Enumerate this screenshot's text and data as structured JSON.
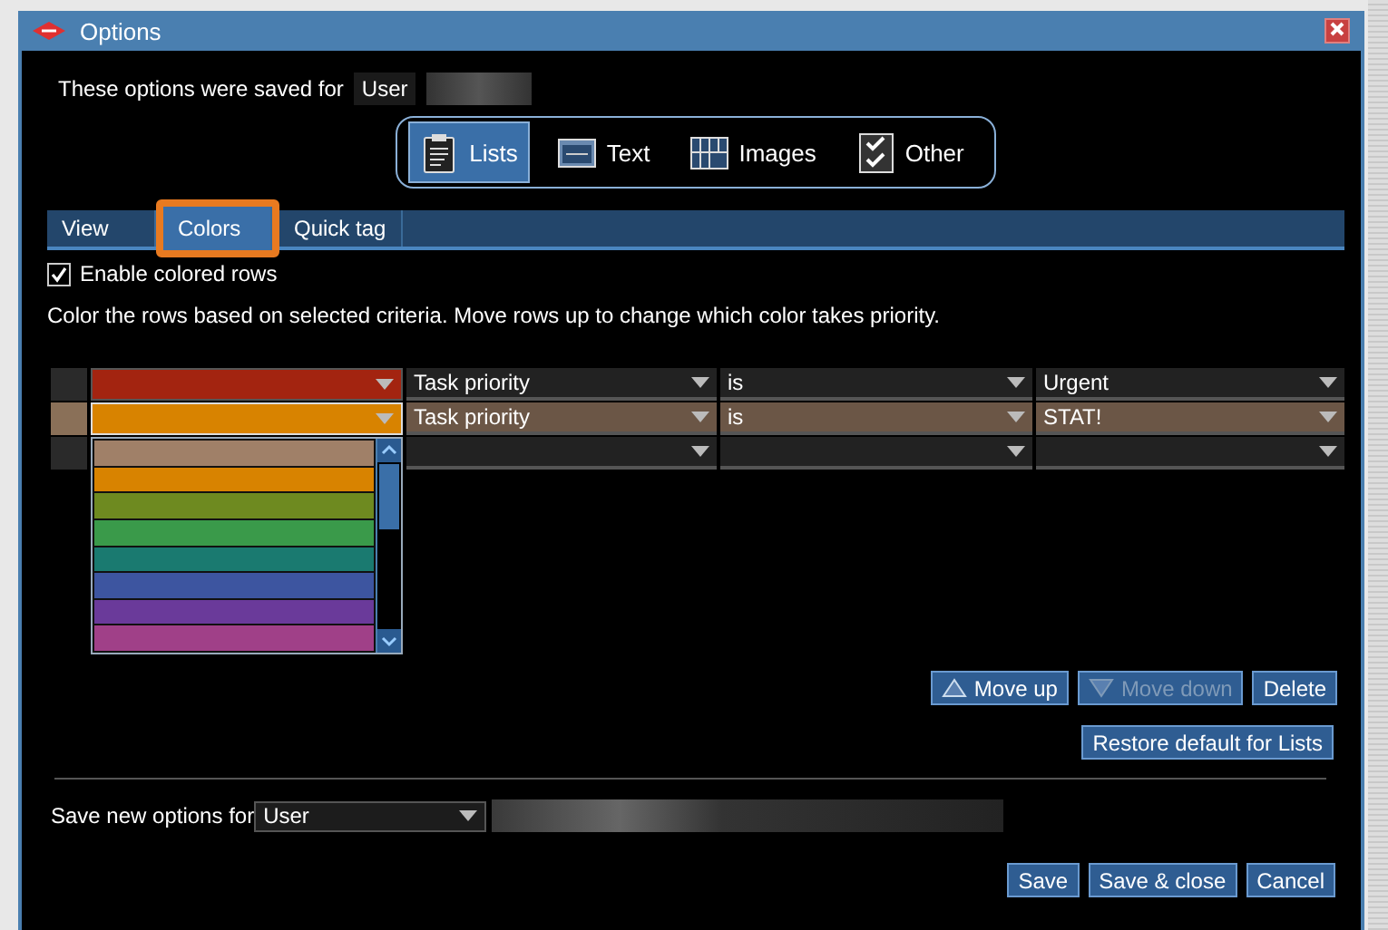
{
  "window": {
    "title": "Options"
  },
  "saved_for": {
    "label": "These options were saved for",
    "user": "User"
  },
  "categories": [
    {
      "label": "Lists",
      "kind": "lists",
      "selected": true
    },
    {
      "label": "Text",
      "kind": "text",
      "selected": false
    },
    {
      "label": "Images",
      "kind": "images",
      "selected": false
    },
    {
      "label": "Other",
      "kind": "other",
      "selected": false
    }
  ],
  "tabs": [
    {
      "label": "View",
      "selected": false,
      "highlighted": false
    },
    {
      "label": "Colors",
      "selected": true,
      "highlighted": true
    },
    {
      "label": "Quick tag",
      "selected": false,
      "highlighted": false
    }
  ],
  "enable_colored_rows": {
    "label": "Enable colored rows",
    "checked": true
  },
  "description": "Color the rows based on selected criteria. Move rows up to change which color takes priority.",
  "rules": [
    {
      "color": "#a32410",
      "field": "Task priority",
      "operator": "is",
      "value": "Urgent",
      "selected": false
    },
    {
      "color": "#d88300",
      "field": "Task priority",
      "operator": "is",
      "value": "STAT!",
      "selected": true
    },
    {
      "selected": false
    }
  ],
  "color_menu": {
    "open": true,
    "options": [
      {
        "color": "#a08068"
      },
      {
        "color": "#d88300"
      },
      {
        "color": "#6e8a20"
      },
      {
        "color": "#3a9a4a"
      },
      {
        "color": "#1a7a70"
      },
      {
        "color": "#3d55a0"
      },
      {
        "color": "#6a3a9a"
      },
      {
        "color": "#a04088"
      }
    ]
  },
  "row_buttons": [
    {
      "label": "Move up",
      "kind": "up",
      "disabled": false
    },
    {
      "label": "Move down",
      "kind": "down",
      "disabled": true
    },
    {
      "label": "Delete",
      "kind": "plain",
      "disabled": false
    }
  ],
  "restore_button": "Restore default for Lists",
  "save_new": {
    "label": "Save new options for",
    "value": "User"
  },
  "footer_buttons": [
    "Save",
    "Save & close",
    "Cancel"
  ]
}
